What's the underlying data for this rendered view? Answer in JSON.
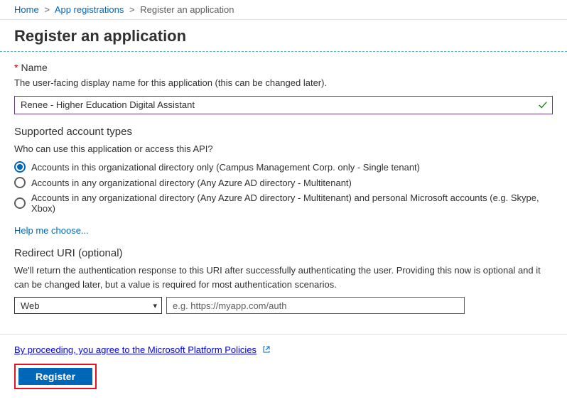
{
  "breadcrumb": {
    "home": "Home",
    "app_reg": "App registrations",
    "current": "Register an application"
  },
  "page_title": "Register an application",
  "name": {
    "label": "Name",
    "desc": "The user-facing display name for this application (this can be changed later).",
    "value": "Renee - Higher Education Digital Assistant"
  },
  "account_types": {
    "heading": "Supported account types",
    "question": "Who can use this application or access this API?",
    "options": [
      "Accounts in this organizational directory only (Campus Management Corp. only - Single tenant)",
      "Accounts in any organizational directory (Any Azure AD directory - Multitenant)",
      "Accounts in any organizational directory (Any Azure AD directory - Multitenant) and personal Microsoft accounts (e.g. Skype, Xbox)"
    ],
    "help_link": "Help me choose..."
  },
  "redirect": {
    "heading": "Redirect URI (optional)",
    "desc": "We'll return the authentication response to this URI after successfully authenticating the user. Providing this now is optional and it can be changed later, but a value is required for most authentication scenarios.",
    "platform_selected": "Web",
    "uri_placeholder": "e.g. https://myapp.com/auth"
  },
  "footer": {
    "policy_text": "By proceeding, you agree to the Microsoft Platform Policies",
    "register_label": "Register"
  }
}
